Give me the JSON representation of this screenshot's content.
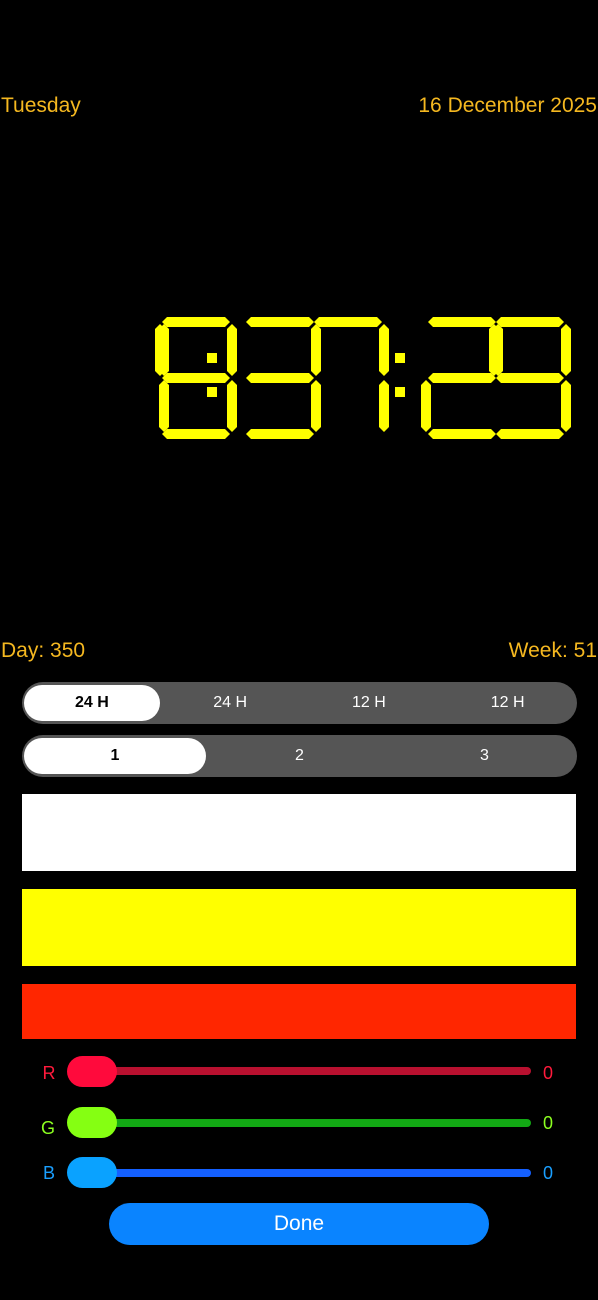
{
  "header": {
    "day_name": "Tuesday",
    "date": "16 December 2025"
  },
  "clock": {
    "time": "19:37:29",
    "digits": [
      "1",
      "9",
      "3",
      "7",
      "2",
      "9"
    ],
    "color": "#ffff00",
    "separator": ":"
  },
  "footer_info": {
    "day": "Day: 350",
    "week": "Week: 51"
  },
  "format_selector": {
    "options": [
      "24 H",
      "24 H",
      "12 H",
      "12 H"
    ],
    "selected_index": 0
  },
  "style_selector": {
    "options": [
      "1",
      "2",
      "3"
    ],
    "selected_index": 0
  },
  "swatches": [
    {
      "color": "#ffffff"
    },
    {
      "color": "#ffff00"
    },
    {
      "color": "#ff2600"
    }
  ],
  "rgb": {
    "r": {
      "label": "R",
      "value": "0",
      "label_color": "#ff1a3c",
      "track_color": "#b8102f",
      "thumb_color": "#ff0a3c"
    },
    "g": {
      "label": "G",
      "value": "0",
      "label_color": "#8cff20",
      "track_color": "#12a814",
      "thumb_color": "#85ff12"
    },
    "b": {
      "label": "B",
      "value": "0",
      "label_color": "#1a9fff",
      "track_color": "#1460ff",
      "thumb_color": "#0aa2ff"
    }
  },
  "done_button": {
    "label": "Done",
    "color": "#0a84ff"
  }
}
